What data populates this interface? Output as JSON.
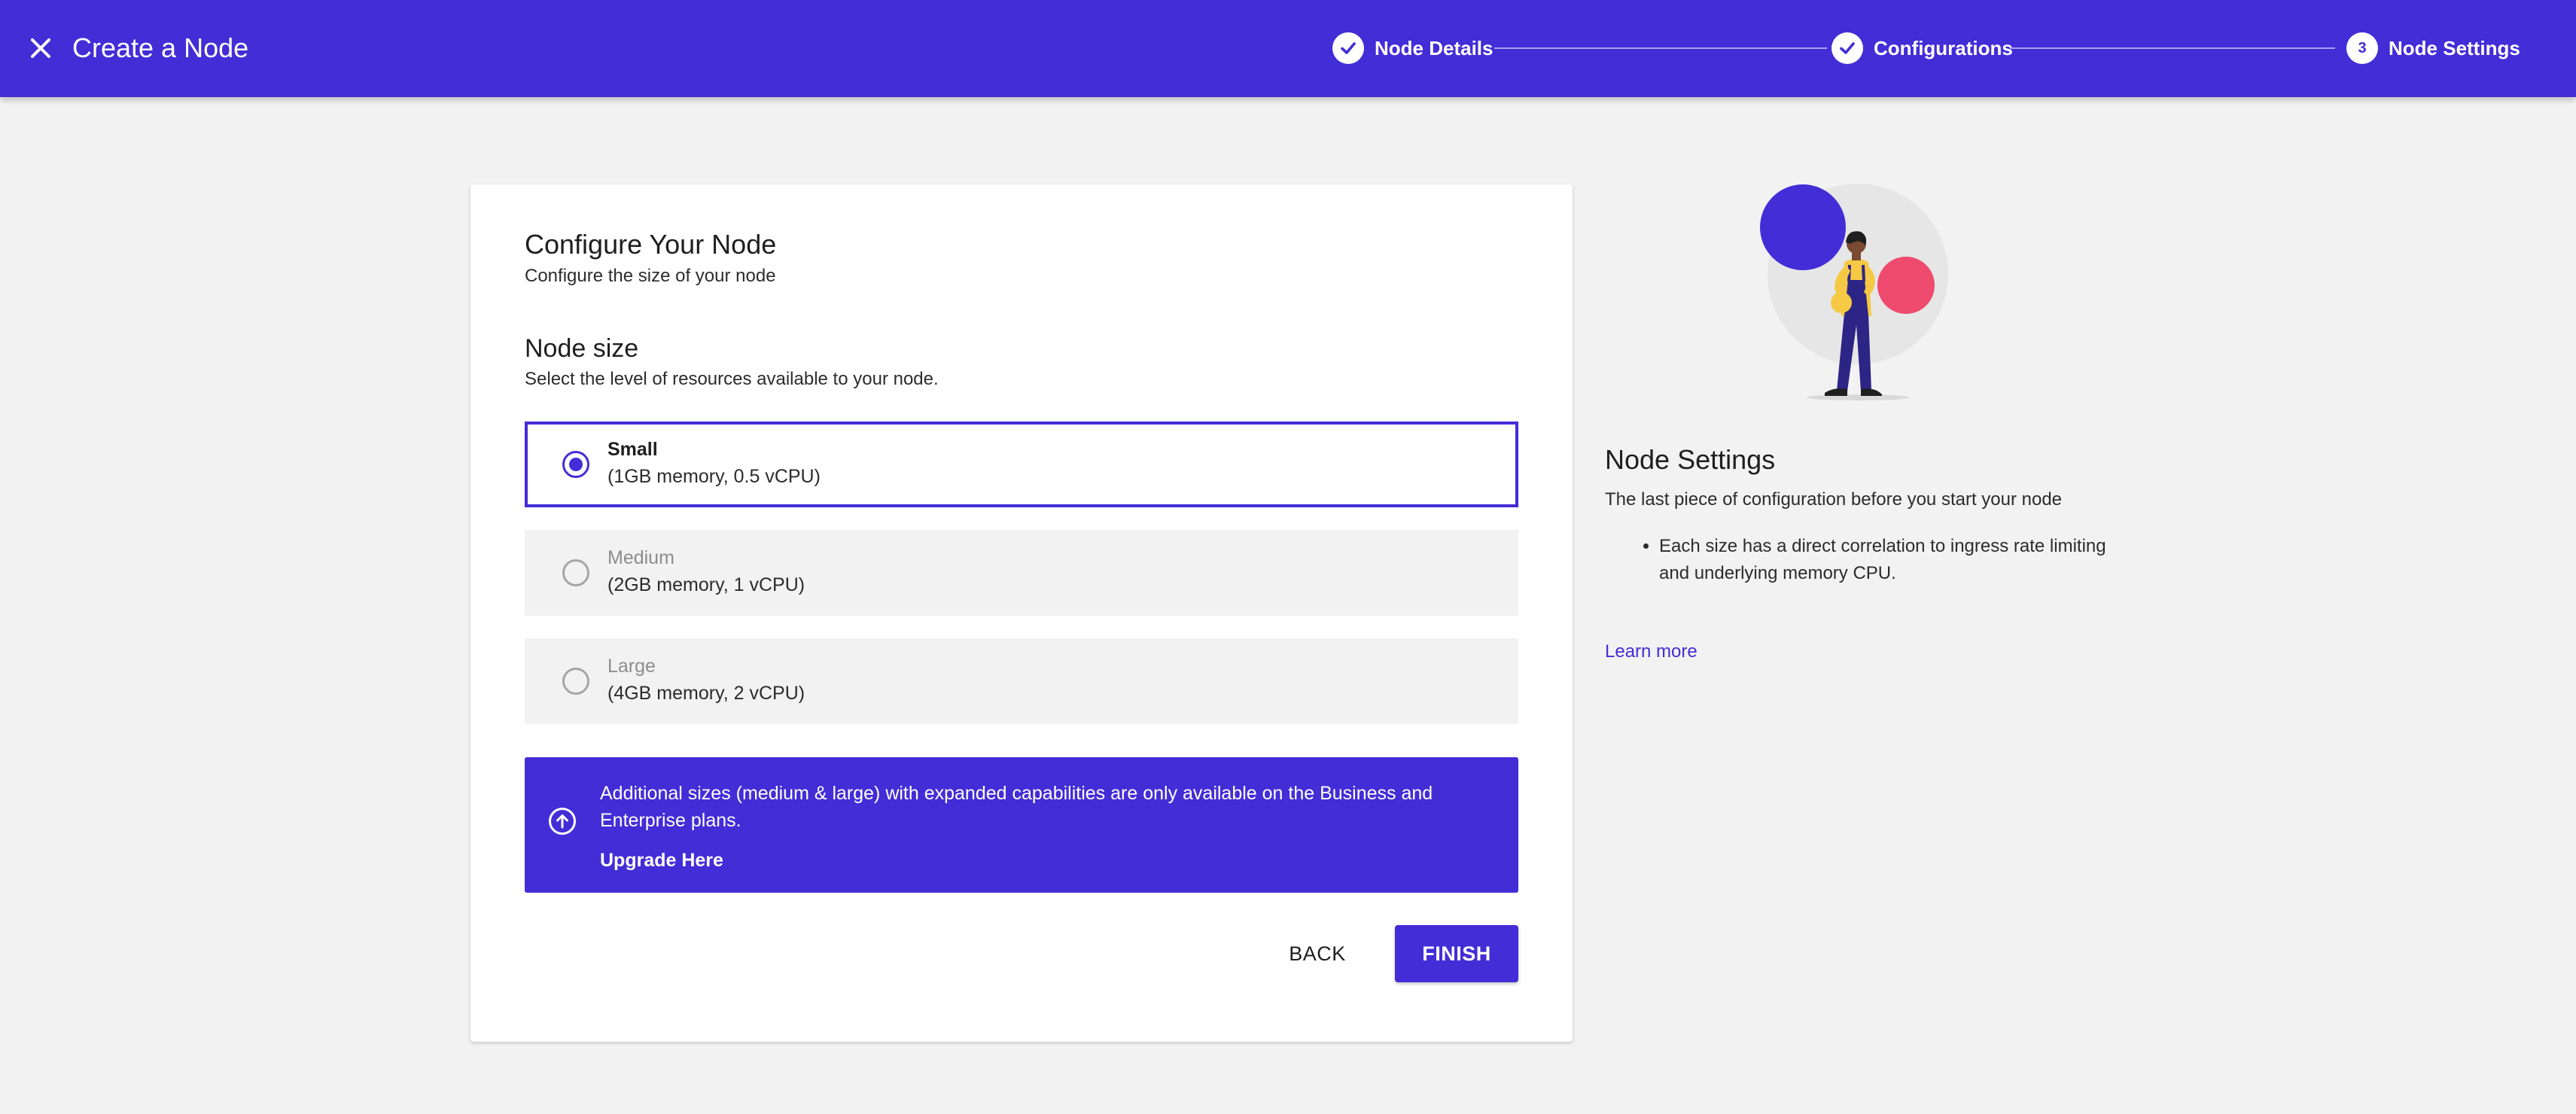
{
  "header": {
    "title": "Create a Node",
    "close_icon": "close-icon",
    "steps": [
      {
        "label": "Node Details",
        "state": "complete",
        "icon": "check-icon"
      },
      {
        "label": "Configurations",
        "state": "complete",
        "icon": "check-icon"
      },
      {
        "label": "Node Settings",
        "state": "current",
        "number": "3"
      }
    ]
  },
  "card": {
    "title": "Configure Your Node",
    "subtitle": "Configure the size of your node",
    "node_size": {
      "title": "Node size",
      "subtitle": "Select the level of resources available to your node.",
      "options": [
        {
          "name": "Small",
          "detail": "(1GB memory, 0.5 vCPU)",
          "selected": true,
          "disabled": false
        },
        {
          "name": "Medium",
          "detail": "(2GB memory, 1 vCPU)",
          "selected": false,
          "disabled": true
        },
        {
          "name": "Large",
          "detail": "(4GB memory, 2 vCPU)",
          "selected": false,
          "disabled": true
        }
      ]
    },
    "banner": {
      "icon": "arrow-up-circle-icon",
      "text": "Additional sizes (medium & large) with expanded capabilities are only available on the Business and Enterprise plans.",
      "link": "Upgrade Here"
    },
    "buttons": {
      "back": "BACK",
      "finish": "FINISH"
    }
  },
  "panel": {
    "title": "Node Settings",
    "text": "The last piece of configuration before you start your node",
    "bullets": [
      "Each size has a direct correlation to ingress rate limiting and underlying memory CPU."
    ],
    "link": "Learn more"
  },
  "colors": {
    "primary": "#432dd7",
    "background": "#f2f2f2",
    "accent_pink": "#ef4b6e",
    "accent_yellow": "#f6c944"
  }
}
